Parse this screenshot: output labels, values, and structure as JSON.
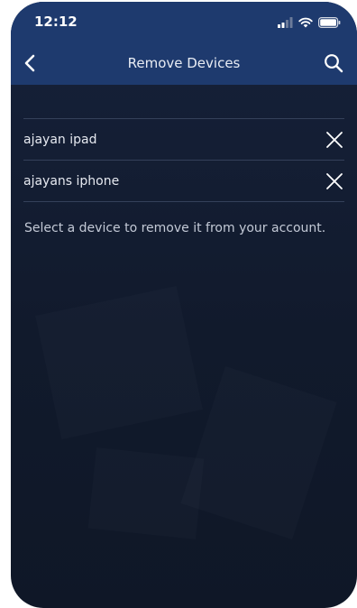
{
  "status_bar": {
    "time": "12:12",
    "icons": [
      "signal-icon",
      "wifi-icon",
      "battery-icon"
    ]
  },
  "nav": {
    "title": "Remove Devices",
    "back_icon": "chevron-left-icon",
    "search_icon": "search-icon"
  },
  "devices": [
    {
      "name": "ajayan ipad",
      "remove_icon": "close-icon"
    },
    {
      "name": "ajayans iphone",
      "remove_icon": "close-icon"
    }
  ],
  "help_text": "Select a device to remove it from your account.",
  "colors": {
    "nav_background": "#1e3a6e",
    "screen_background": "#131c30",
    "divider": "#34405a",
    "text_primary": "#e6e9f0",
    "text_secondary": "#c3c9d6",
    "icon": "#ffffff"
  }
}
